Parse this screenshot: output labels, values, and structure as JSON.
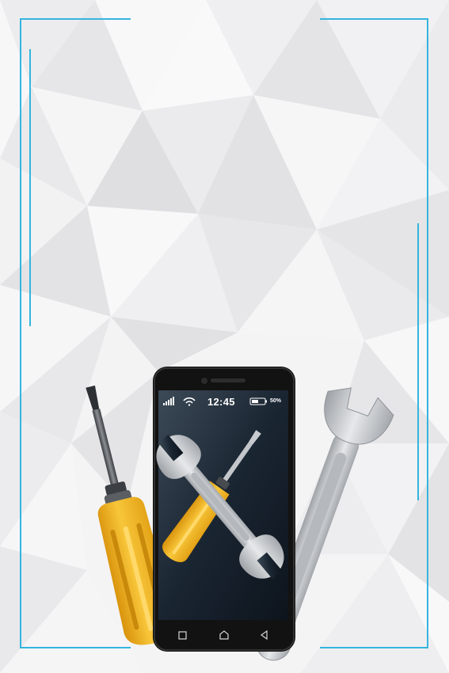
{
  "status_bar": {
    "time": "12:45",
    "battery": "50%",
    "battery_level": 0.5,
    "signal_icon": "signal-bars-icon",
    "wifi_icon": "wifi-icon"
  },
  "nav_icons": [
    "square-recent-apps-icon",
    "home-icon",
    "back-triangle-icon"
  ],
  "colors": {
    "frame_blue": "#34b5df",
    "screwdriver_yellow": "#f2b41e",
    "wrench_silver": "#c9ccd0",
    "phone_body": "#141414",
    "screen_dark": "#1c2a38",
    "background": "#f3f3f4"
  }
}
